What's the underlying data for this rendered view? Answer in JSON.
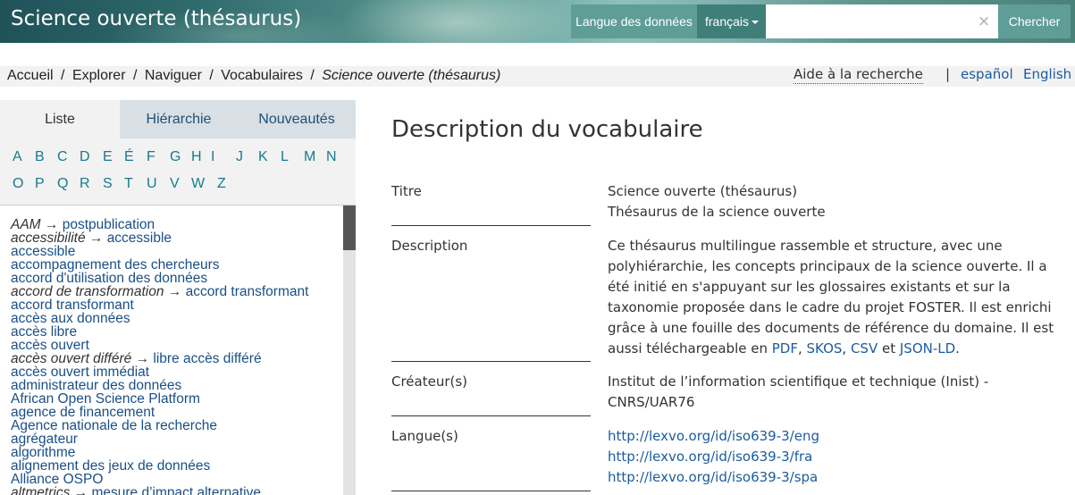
{
  "header": {
    "site_title": "Science ouverte (thésaurus)",
    "data_language_label": "Langue des données",
    "data_language_value": "français",
    "search_placeholder": "",
    "search_clear": "×",
    "search_button": "Chercher"
  },
  "breadcrumb": {
    "items": [
      "Accueil",
      "Explorer",
      "Naviguer",
      "Vocabulaires"
    ],
    "separator": "/",
    "current": "Science ouverte (thésaurus)"
  },
  "utility": {
    "help": "Aide à la recherche",
    "separator": "|",
    "languages": [
      "español",
      "English"
    ]
  },
  "sidebar": {
    "tabs": [
      "Liste",
      "Hiérarchie",
      "Nouveautés"
    ],
    "active_tab": "Liste",
    "letters_row1": [
      "A",
      "B",
      "C",
      "D",
      "E",
      "É",
      "F",
      "G",
      "H",
      "I",
      "J",
      "K",
      "L",
      "M",
      "N"
    ],
    "letters_row2": [
      "O",
      "P",
      "Q",
      "R",
      "S",
      "T",
      "U",
      "V",
      "W",
      "Z"
    ],
    "concepts": [
      {
        "alt": "AAM",
        "target": "postpublication"
      },
      {
        "alt": "accessibilité",
        "target": "accessible"
      },
      {
        "label": "accessible"
      },
      {
        "label": "accompagnement des chercheurs"
      },
      {
        "label": "accord d'utilisation des données"
      },
      {
        "alt": "accord de transformation",
        "target": "accord transformant"
      },
      {
        "label": "accord transformant"
      },
      {
        "label": "accès aux données"
      },
      {
        "label": "accès libre"
      },
      {
        "label": "accès ouvert"
      },
      {
        "alt": "accès ouvert différé",
        "target": "libre accès différé"
      },
      {
        "label": "accès ouvert immédiat"
      },
      {
        "label": "administrateur des données"
      },
      {
        "label": "African Open Science Platform"
      },
      {
        "label": "agence de financement"
      },
      {
        "label": "Agence nationale de la recherche"
      },
      {
        "label": "agrégateur"
      },
      {
        "label": "algorithme"
      },
      {
        "label": "alignement des jeux de données"
      },
      {
        "label": "Alliance OSPO"
      },
      {
        "alt": "altmetrics",
        "target": "mesure d’impact alternative"
      }
    ],
    "arrow": "→"
  },
  "main": {
    "title": "Description du vocabulaire",
    "properties": {
      "titre_label": "Titre",
      "titre_values": [
        "Science ouverte (thésaurus)",
        "Thésaurus de la science ouverte"
      ],
      "description_label": "Description",
      "description_lines": [
        "Ce thésaurus multilingue rassemble et structure, avec une",
        "polyhiérarchie, les concepts principaux de la science ouverte. Il a",
        "été initié en s'appuyant sur les glossaires existants et sur la",
        "taxonomie proposée dans le cadre du projet FOSTER. Il est enrichi",
        "grâce à une fouille des documents de référence du domaine. Il est"
      ],
      "description_last_prefix": "aussi téléchargeable en ",
      "description_links": [
        "PDF",
        "SKOS",
        "CSV",
        "JSON-LD"
      ],
      "description_sep1": ", ",
      "description_sep2": ", ",
      "description_and": " et ",
      "description_end": ".",
      "creator_label": "Créateur(s)",
      "creator_lines": [
        "Institut de l’information scientifique et technique (Inist) -",
        "CNRS/UAR76"
      ],
      "language_label": "Langue(s)",
      "language_links": [
        "http://lexvo.org/id/iso639-3/eng",
        "http://lexvo.org/id/iso639-3/fra",
        "http://lexvo.org/id/iso639-3/spa"
      ]
    }
  }
}
